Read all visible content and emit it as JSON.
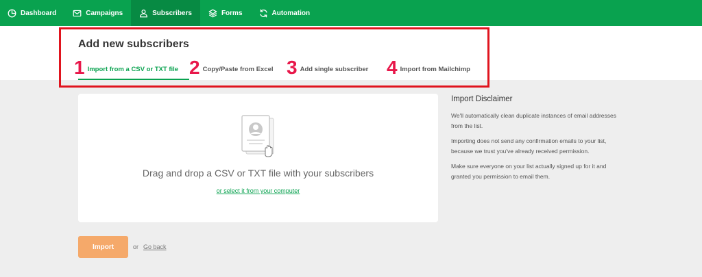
{
  "nav": {
    "items": [
      {
        "label": "Dashboard",
        "icon": "dashboard-icon"
      },
      {
        "label": "Campaigns",
        "icon": "mail-icon"
      },
      {
        "label": "Subscribers",
        "icon": "user-icon",
        "active": true
      },
      {
        "label": "Forms",
        "icon": "layers-icon"
      },
      {
        "label": "Automation",
        "icon": "refresh-icon"
      }
    ]
  },
  "header": {
    "title": "Add new subscribers"
  },
  "tabs": [
    {
      "number": "1",
      "label": "Import from a CSV or TXT file",
      "active": true
    },
    {
      "number": "2",
      "label": "Copy/Paste from Excel"
    },
    {
      "number": "3",
      "label": "Add single subscriber"
    },
    {
      "number": "4",
      "label": "Import from Mailchimp"
    }
  ],
  "dropzone": {
    "icon": "document-drag-icon",
    "text": "Drag and drop a CSV or TXT file with your subscribers",
    "link": "or select it from your computer"
  },
  "disclaimer": {
    "title": "Import Disclaimer",
    "paragraphs": [
      "We'll automatically clean duplicate instances of email addresses from the list.",
      "Importing does not send any confirmation emails to your list, because we trust you've already received permission.",
      "Make sure everyone on your list actually signed up for it and granted you permission to email them."
    ]
  },
  "actions": {
    "import_label": "Import",
    "or_text": "or",
    "back_label": "Go back"
  },
  "colors": {
    "nav_green": "#09a24f",
    "tab_number_red": "#e8174a",
    "highlight_red": "#e0141e",
    "import_orange": "#f5a96a"
  }
}
